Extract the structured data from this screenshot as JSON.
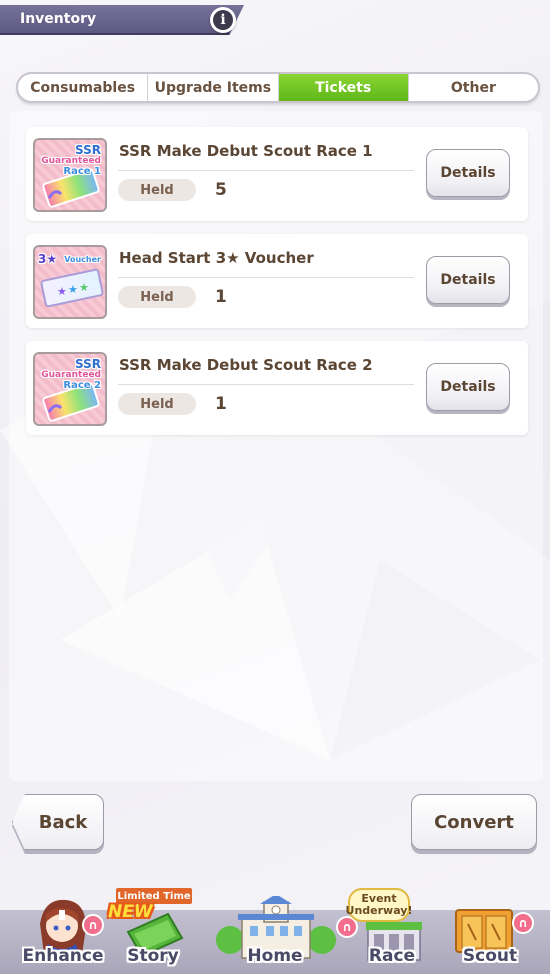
{
  "header": {
    "title": "Inventory",
    "info_icon": "info-icon"
  },
  "tabs": [
    {
      "label": "Consumables",
      "active": false
    },
    {
      "label": "Upgrade Items",
      "active": false
    },
    {
      "label": "Tickets",
      "active": true
    },
    {
      "label": "Other",
      "active": false
    }
  ],
  "items": [
    {
      "name": "SSR Make Debut Scout Race 1",
      "held_label": "Held",
      "count": "5",
      "thumb_text": [
        "SSR",
        "Guaranteed",
        "Race 1"
      ],
      "details_label": "Details"
    },
    {
      "name": "Head Start 3★ Voucher",
      "held_label": "Held",
      "count": "1",
      "thumb_text": [
        "3★",
        "Voucher"
      ],
      "details_label": "Details"
    },
    {
      "name": "SSR Make Debut Scout Race 2",
      "held_label": "Held",
      "count": "1",
      "thumb_text": [
        "SSR",
        "Guaranteed",
        "Race 2"
      ],
      "details_label": "Details"
    }
  ],
  "actions": {
    "back_label": "Back",
    "convert_label": "Convert"
  },
  "nav": {
    "enhance": "Enhance",
    "story": "Story",
    "story_badge_top": "Limited Time",
    "story_badge_new": "NEW",
    "home": "Home",
    "race": "Race",
    "race_badge": "Event Underway!",
    "scout": "Scout"
  },
  "colors": {
    "tab_active": "#6fc423",
    "header_bg": "#6a6690",
    "text_brown": "#5b4533"
  }
}
